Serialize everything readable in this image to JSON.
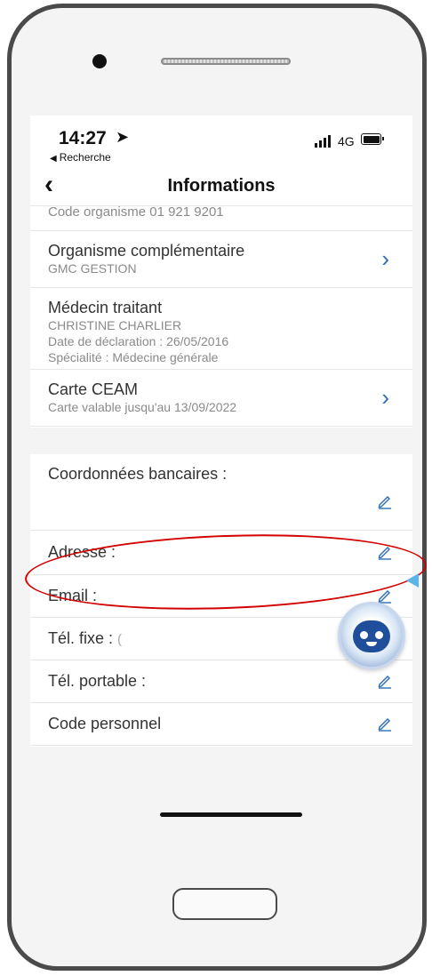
{
  "status": {
    "time": "14:27",
    "back_app": "Recherche",
    "network": "4G"
  },
  "nav": {
    "title": "Informations"
  },
  "rows": {
    "code_organisme": "Code organisme 01 921 9201",
    "organisme": {
      "title": "Organisme complémentaire",
      "sub": "GMC GESTION"
    },
    "medecin": {
      "title": "Médecin traitant",
      "name": "CHRISTINE CHARLIER",
      "date": "Date de déclaration : 26/05/2016",
      "specialite": "Spécialité : Médecine générale"
    },
    "ceam": {
      "title": "Carte CEAM",
      "sub": "Carte valable jusqu'au 13/09/2022"
    },
    "coordonnees": "Coordonnées bancaires :",
    "adresse": "Adresse :",
    "email": "Email :",
    "tel_fixe": "Tél. fixe :",
    "tel_fixe_value": "(",
    "tel_portable": "Tél. portable :",
    "code_personnel": "Code personnel"
  },
  "icons": {
    "location": "location-arrow-icon",
    "edit": "pencil-icon",
    "chevron": "chevron-right-icon",
    "chatbot": "robot-assistant-icon"
  },
  "colors": {
    "accent": "#2b6db5",
    "highlight": "#d20000",
    "pointer": "#5ab4e6"
  }
}
